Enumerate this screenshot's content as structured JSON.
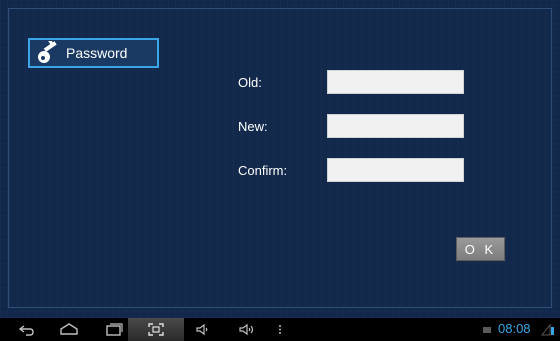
{
  "password_button": {
    "label": "Password",
    "icon": "key-icon"
  },
  "form": {
    "fields": [
      {
        "label": "Old:",
        "value": ""
      },
      {
        "label": "New:",
        "value": ""
      },
      {
        "label": "Confirm:",
        "value": ""
      }
    ],
    "ok_label": "O K"
  },
  "status_bar": {
    "clock": "08:08",
    "icons": [
      "back-icon",
      "home-icon",
      "recent-apps-icon",
      "screenshot-icon",
      "volume-down-icon",
      "volume-up-icon",
      "menu-icon",
      "notification-icon",
      "signal-icon"
    ]
  },
  "colors": {
    "accent": "#3aa6e8",
    "background": "#13294c"
  }
}
